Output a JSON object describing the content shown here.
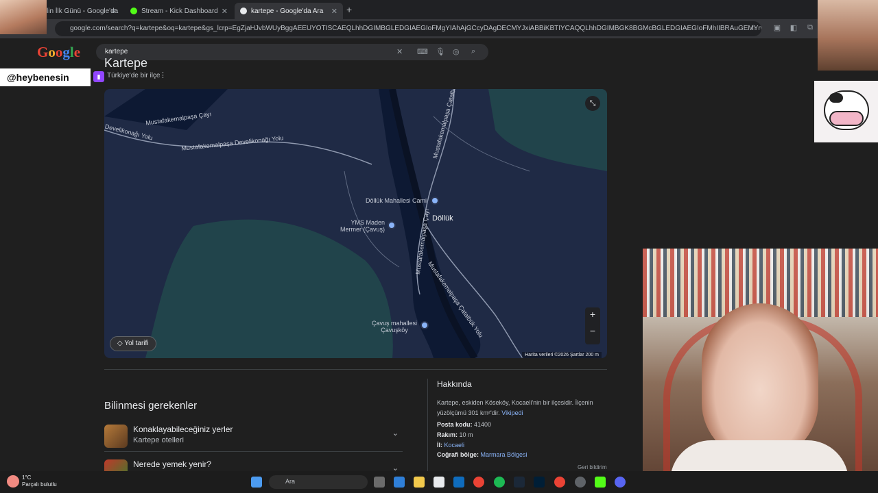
{
  "browser": {
    "tabs": [
      {
        "label": "lin İlk Günü - Google'da",
        "favicon_color": "#4285f4"
      },
      {
        "label": "Stream - Kick Dashboard",
        "favicon_color": "#53fc18"
      },
      {
        "label": "kartepe - Google'da Ara",
        "favicon_color": "#e8eaed"
      }
    ],
    "new_tab": "+",
    "close": "✕",
    "url": "google.com/search?q=kartepe&oq=kartepe&gs_lcrp=EgZjaHJvbWUyBggAEEUYOTISCAEQLhhDGIMBGLEDGIAEGIoFMgYIAhAjGCcyDAgDECMYJxiABBiKBTIYCAQQLhhDGIMBGK8BGMcBGLEDGIAEGIoFMhIIBRAuGEMYrwEYxwEYgAQYigUyCg..."
  },
  "google": {
    "logo": "Google",
    "search_value": "kartepe",
    "clear": "✕"
  },
  "knowledge": {
    "title": "Kartepe",
    "subtitle": "Türkiye'de bir ilçe",
    "more": "⋮"
  },
  "map": {
    "labels": {
      "road1": "Mustafakemalpaşa Çayı",
      "road2": "Develikonağı Yolu",
      "road3": "Mustafakemalpaşa Develikonağı Yolu",
      "mosque": "Döllük Mahallesi Cami",
      "place_big": "Döllük",
      "mine": "YMS Maden\nMermer (Çavuş)",
      "village": "Çavuş mahallesi\nÇavuşköy",
      "road4": "Mustafakemalpaşa Çatalbük Yolu",
      "road5": "Mustafakemalpaşa Çayı",
      "road6": "Mustafakemalpaşa Çatalbük Yolu"
    },
    "route_button": "Yol tarifi",
    "zoom_in": "+",
    "zoom_out": "−",
    "attribution": "Harita verileri ©2026   Şartlar   200 m"
  },
  "know": {
    "heading": "Bilinmesi gerekenler",
    "items": [
      {
        "title": "Konaklayabileceğiniz yerler",
        "subtitle": "Kartepe otelleri"
      },
      {
        "title": "Nerede yemek yenir?",
        "subtitle": ""
      }
    ]
  },
  "about": {
    "heading": "Hakkında",
    "text": "Kartepe, eskiden Köseköy, Kocaeli'nin bir ilçesidir. İlçenin yüzölçümü 301 km²'dir.",
    "source": "Vikipedi",
    "facts": [
      {
        "label": "Posta kodu:",
        "value": "41400"
      },
      {
        "label": "Rakım:",
        "value": "10 m"
      },
      {
        "label": "İl:",
        "value": "Kocaeli"
      },
      {
        "label": "Coğrafi bölge:",
        "value": "Marmara Bölgesi"
      }
    ],
    "feedback": "Geri bildirim"
  },
  "overlay": {
    "handle": "@heybenesin"
  },
  "taskbar": {
    "temp": "1°C",
    "weather": "Parçalı bulutlu",
    "search": "Ara"
  }
}
